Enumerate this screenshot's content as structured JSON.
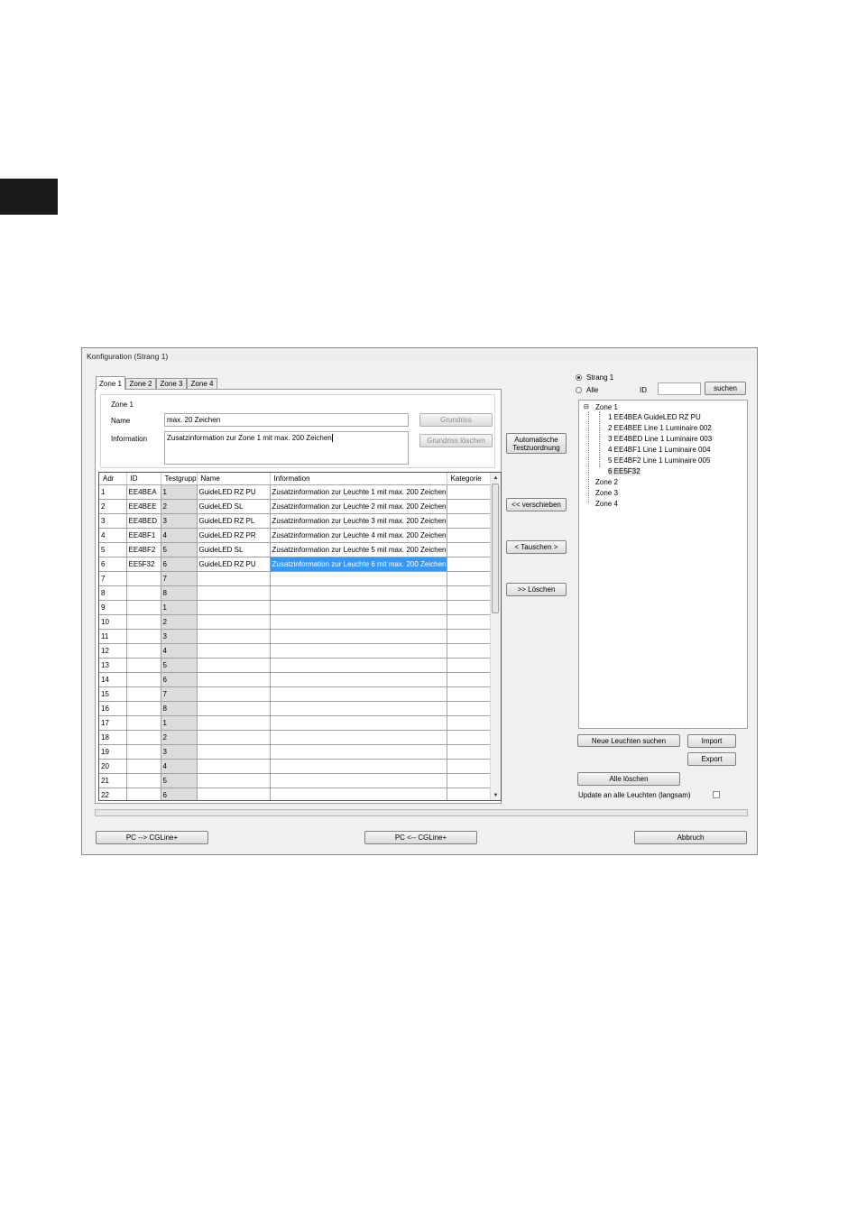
{
  "window": {
    "title": "Konfiguration (Strang 1)"
  },
  "tabs": [
    "Zone 1",
    "Zone 2",
    "Zone 3",
    "Zone 4"
  ],
  "zone_group": {
    "title": "Zone 1",
    "name_label": "Name",
    "name_value": "max. 20 Zeichen",
    "info_label": "Information",
    "info_value": "Zusatzinformation zur Zone 1 mit max. 200 Zeichen",
    "grundriss_button": "Grundriss",
    "grundriss_loeschen_button": "Grundriss löschen"
  },
  "table": {
    "columns": [
      "Adr",
      "ID",
      "Testgruppe",
      "Name",
      "Information",
      "Kategorie"
    ],
    "rows": [
      [
        "1",
        "EE4BEA",
        "1",
        "GuideLED RZ PU",
        "Zusatzinformation zur Leuchte 1 mit max. 200 Zeichen",
        ""
      ],
      [
        "2",
        "EE4BEE",
        "2",
        "GuideLED SL",
        "Zusatzinformation zur Leuchte 2 mit max. 200 Zeichen",
        ""
      ],
      [
        "3",
        "EE4BED",
        "3",
        "GuideLED RZ PL",
        "Zusatzinformation zur Leuchte 3 mit max. 200 Zeichen",
        ""
      ],
      [
        "4",
        "EE4BF1",
        "4",
        "GuideLED RZ PR",
        "Zusatzinformation zur Leuchte 4 mit max. 200 Zeichen",
        ""
      ],
      [
        "5",
        "EE4BF2",
        "5",
        "GuideLED SL",
        "Zusatzinformation zur Leuchte 5 mit max. 200 Zeichen",
        ""
      ],
      [
        "6",
        "EE5F32",
        "6",
        "GuideLED RZ PU",
        "Zusatzinformation zur Leuchte 6 mit max. 200 Zeichen",
        ""
      ],
      [
        "7",
        "",
        "7",
        "",
        "",
        ""
      ],
      [
        "8",
        "",
        "8",
        "",
        "",
        ""
      ],
      [
        "9",
        "",
        "1",
        "",
        "",
        ""
      ],
      [
        "10",
        "",
        "2",
        "",
        "",
        ""
      ],
      [
        "11",
        "",
        "3",
        "",
        "",
        ""
      ],
      [
        "12",
        "",
        "4",
        "",
        "",
        ""
      ],
      [
        "13",
        "",
        "5",
        "",
        "",
        ""
      ],
      [
        "14",
        "",
        "6",
        "",
        "",
        ""
      ],
      [
        "15",
        "",
        "7",
        "",
        "",
        ""
      ],
      [
        "16",
        "",
        "8",
        "",
        "",
        ""
      ],
      [
        "17",
        "",
        "1",
        "",
        "",
        ""
      ],
      [
        "18",
        "",
        "2",
        "",
        "",
        ""
      ],
      [
        "19",
        "",
        "3",
        "",
        "",
        ""
      ],
      [
        "20",
        "",
        "4",
        "",
        "",
        ""
      ],
      [
        "21",
        "",
        "5",
        "",
        "",
        ""
      ],
      [
        "22",
        "",
        "6",
        "",
        "",
        ""
      ]
    ],
    "selected_row": 6
  },
  "middle_buttons": {
    "auto_line1": "Automatische",
    "auto_line2": "Testzuordnung",
    "verschieben": "<< verschieben",
    "tauschen": "< Tauschen >",
    "loeschen": ">> Löschen"
  },
  "right": {
    "radio_strang": "Strang 1",
    "radio_alle": "Alle",
    "id_label": "ID",
    "id_value": "",
    "suchen_button": "suchen",
    "tree": {
      "zone1": "Zone 1",
      "items": [
        "1 EE4BEA GuideLED RZ PU",
        "2 EE4BEE Line 1 Luminaire 002",
        "3 EE4BED Line 1 Luminaire 003",
        "4 EE4BF1 Line 1 Luminaire 004",
        "5 EE4BF2 Line 1 Luminaire 005",
        "6 EE5F32"
      ],
      "zone2": "Zone 2",
      "zone3": "Zone 3",
      "zone4": "Zone 4"
    },
    "neue_leuchten_button": "Neue Leuchten suchen",
    "import_button": "Import",
    "export_button": "Export",
    "alle_loeschen_button": "Alle löschen",
    "update_label": "Update an alle Leuchten (langsam)"
  },
  "bottom": {
    "pc_to_cg": "PC --> CGLine+",
    "cg_to_pc": "PC <-- CGLine+",
    "abbruch": "Abbruch"
  }
}
